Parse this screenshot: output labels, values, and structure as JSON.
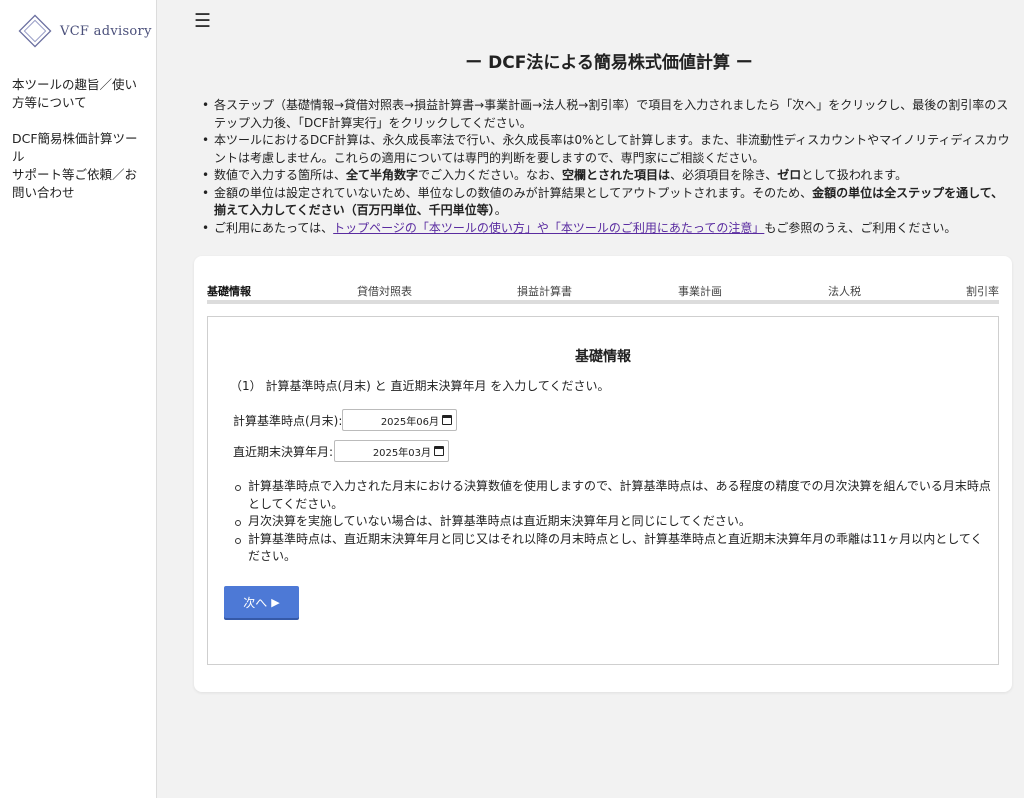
{
  "app": {
    "brand": "VCF advisory"
  },
  "sidebar": {
    "items": [
      {
        "label": "本ツールの趣旨／使い方等について"
      },
      {
        "label": "DCF簡易株価計算ツール"
      },
      {
        "label": "サポート等ご依頼／お問い合わせ"
      }
    ]
  },
  "header": {
    "title": "ー DCF法による簡易株式価値計算 ー"
  },
  "notes": {
    "n1": "各ステップ（基礎情報→貸借対照表→損益計算書→事業計画→法人税→割引率）で項目を入力されましたら「次へ」をクリックし、最後の割引率のステップ入力後、「DCF計算実行」をクリックしてください。",
    "n2": "本ツールにおけるDCF計算は、永久成長率法で行い、永久成長率は0%として計算します。また、非流動性ディスカウントやマイノリティディスカウントは考慮しません。これらの適用については専門的判断を要しますので、専門家にご相談ください。",
    "n3_a": "数値で入力する箇所は、",
    "n3_b": "全て半角数字",
    "n3_c": "でご入力ください。なお、",
    "n3_d": "空欄とされた項目は",
    "n3_e": "、必須項目を除き、",
    "n3_f": "ゼロ",
    "n3_g": "として扱われます。",
    "n4_a": "金額の単位は設定されていないため、単位なしの数値のみが計算結果としてアウトプットされます。そのため、",
    "n4_b": "金額の単位は全ステップを通して、揃えて入力してください（百万円単位、千円単位等）",
    "n4_c": "。",
    "n5_a": "ご利用にあたっては、",
    "n5_link": "トップページの「本ツールの使い方」や「本ツールのご利用にあたっての注意」",
    "n5_b": "もご参照のうえ、ご利用ください。"
  },
  "steps": [
    "基礎情報",
    "貸借対照表",
    "損益計算書",
    "事業計画",
    "法人税",
    "割引率"
  ],
  "form": {
    "section_title": "基礎情報",
    "instruction": "（1） 計算基準時点(月末) と 直近期末決算年月 を入力してください。",
    "field1_label": "計算基準時点(月末):",
    "field1_value": "2025年06月",
    "field2_label": "直近期末決算年月:",
    "field2_value": "2025年03月",
    "hints": [
      "計算基準時点で入力された月末における決算数値を使用しますので、計算基準時点は、ある程度の精度での月次決算を組んでいる月末時点としてください。",
      "月次決算を実施していない場合は、計算基準時点は直近期末決算年月と同じにしてください。",
      "計算基準時点は、直近期末決算年月と同じ又はそれ以降の月末時点とし、計算基準時点と直近期末決算年月の乖離は11ヶ月以内としてください。"
    ],
    "next_label": "次へ",
    "next_arrow": "▶"
  }
}
